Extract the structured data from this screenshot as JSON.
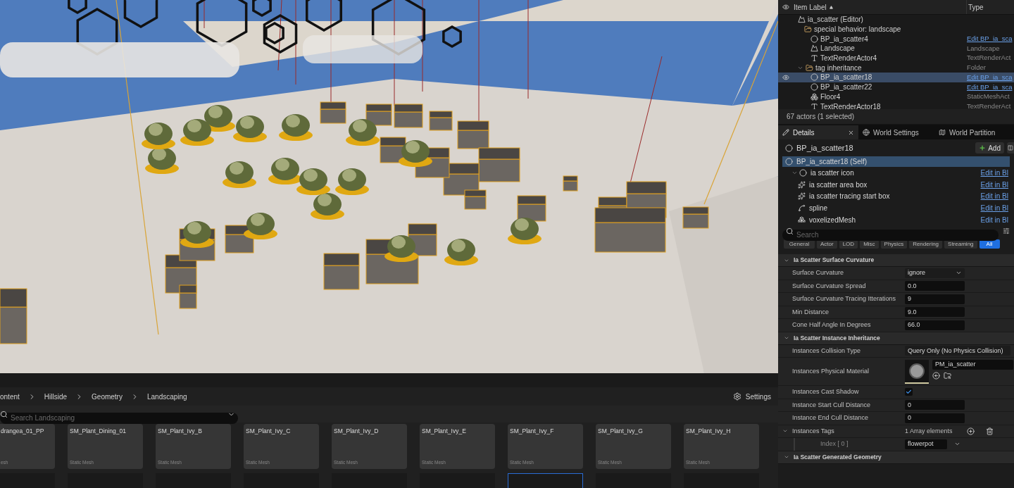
{
  "outliner": {
    "columns": [
      "Item Label",
      "Type"
    ],
    "rows": [
      {
        "label": "ia_scatter (Editor)",
        "kind": "editor",
        "selected": false,
        "visible": false,
        "children": [
          {
            "label": "special behavior: landscape",
            "kind": "folder",
            "selected": false,
            "visible": false,
            "children": [
              {
                "label": "BP_ia_scatter4",
                "kind": "actor",
                "type": "Edit BP_ia_sca",
                "link": true,
                "selected": false,
                "visible": false
              },
              {
                "label": "Landscape",
                "kind": "landscape",
                "type": "Landscape",
                "link": false,
                "selected": false,
                "visible": false
              },
              {
                "label": "TextRenderActor4",
                "kind": "text",
                "type": "TextRenderAct",
                "link": false,
                "selected": false,
                "visible": false
              }
            ]
          },
          {
            "label": "tag inheritance",
            "kind": "folder",
            "type": "Folder",
            "link": false,
            "expanded": true,
            "selected": false,
            "visible": false,
            "children": [
              {
                "label": "BP_ia_scatter18",
                "kind": "actor",
                "type": "Edit BP_ia_sca",
                "link": true,
                "selected": true,
                "visible": true
              },
              {
                "label": "BP_ia_scatter22",
                "kind": "actor",
                "type": "Edit BP_ia_sca",
                "link": true,
                "selected": false,
                "visible": false
              },
              {
                "label": "Floor4",
                "kind": "mesh",
                "type": "StaticMeshAct",
                "link": false,
                "selected": false,
                "visible": false
              },
              {
                "label": "TextRenderActor18",
                "kind": "text",
                "type": "TextRenderAct",
                "link": false,
                "selected": false,
                "visible": false
              }
            ]
          }
        ]
      }
    ],
    "status": "67 actors (1 selected)"
  },
  "details": {
    "tabs": [
      {
        "label": "Details",
        "kind": "details",
        "selected": true,
        "closable": true
      },
      {
        "label": "World Settings",
        "kind": "world",
        "selected": false,
        "closable": false
      },
      {
        "label": "World Partition",
        "kind": "partition",
        "selected": false,
        "closable": false
      }
    ],
    "actor_name": "BP_ia_scatter18",
    "add_button": "Add",
    "components": [
      {
        "label": "BP_ia_scatter18 (Self)",
        "kind": "actor",
        "selected": true,
        "children": [
          {
            "label": "ia scatter icon",
            "kind": "sphere",
            "link": "Edit in Bl",
            "expanded": true,
            "selected": false,
            "children": [
              {
                "label": "ia scatter area box",
                "kind": "box",
                "link": "Edit in Bl",
                "selected": false
              },
              {
                "label": "ia scatter tracing start box",
                "kind": "box",
                "link": "Edit in Bl",
                "selected": false
              },
              {
                "label": "spline",
                "kind": "spline",
                "link": "Edit in Bl",
                "selected": false
              },
              {
                "label": "voxelizedMesh",
                "kind": "mesh",
                "link": "Edit in Bl",
                "selected": false
              }
            ]
          }
        ]
      }
    ],
    "search": {
      "placeholder": "Search"
    },
    "filters": [
      {
        "label": "General",
        "selected": false
      },
      {
        "label": "Actor",
        "selected": false
      },
      {
        "label": "LOD",
        "selected": false
      },
      {
        "label": "Misc",
        "selected": false
      },
      {
        "label": "Physics",
        "selected": false
      },
      {
        "label": "Rendering",
        "selected": false
      },
      {
        "label": "Streaming",
        "selected": false
      },
      {
        "label": "All",
        "selected": true
      }
    ],
    "sections": [
      {
        "title": "Ia Scatter Surface Curvature",
        "expanded": true,
        "properties": [
          {
            "kind": "dropdown",
            "label": "Surface Curvature",
            "value": "ignore"
          },
          {
            "kind": "number",
            "label": "Surface Curvature Spread",
            "value": "0.0"
          },
          {
            "kind": "number",
            "label": "Surface Curvature Tracing Itterations",
            "value": "9"
          },
          {
            "kind": "number",
            "label": "Min Distance",
            "value": "9.0"
          },
          {
            "kind": "number",
            "label": "Cone Half Angle In Degrees",
            "value": "66.0"
          }
        ]
      },
      {
        "title": "Ia Scatter Instance Inheritance",
        "expanded": true,
        "properties": [
          {
            "kind": "dropdown",
            "label": "Instances Collision Type",
            "value": "Query Only (No Physics Collision)"
          },
          {
            "kind": "material",
            "label": "Instances Physical Material",
            "value": "PM_ia_scatter"
          },
          {
            "kind": "checkbox",
            "label": "Instances Cast Shadow",
            "checked": true
          },
          {
            "kind": "number",
            "label": "Instance Start Cull Distance",
            "value": "0"
          },
          {
            "kind": "number",
            "label": "Instance End Cull Distance",
            "value": "0"
          },
          {
            "kind": "array",
            "label": "Instances Tags",
            "value": "1 Array elements",
            "expanded": true
          },
          {
            "kind": "element",
            "label": "Index [ 0 ]",
            "value": "flowerpot"
          }
        ]
      },
      {
        "title": "Ia Scatter Generated Geometry",
        "expanded": true
      }
    ]
  },
  "content_browser": {
    "breadcrumb": [
      "ontent",
      "Hillside",
      "Geometry",
      "Landscaping"
    ],
    "settings": "Settings",
    "search": {
      "placeholder": "Search Landscaping"
    },
    "assets": [
      {
        "name": "drangea_01_PP",
        "type": "esh"
      },
      {
        "name": "SM_Plant_Dining_01",
        "type": "Static Mesh"
      },
      {
        "name": "SM_Plant_Ivy_B",
        "type": "Static Mesh"
      },
      {
        "name": "SM_Plant_Ivy_C",
        "type": "Static Mesh"
      },
      {
        "name": "SM_Plant_Ivy_D",
        "type": "Static Mesh"
      },
      {
        "name": "SM_Plant_Ivy_E",
        "type": "Static Mesh"
      },
      {
        "name": "SM_Plant_Ivy_F",
        "type": "Static Mesh"
      },
      {
        "name": "SM_Plant_Ivy_G",
        "type": "Static Mesh"
      },
      {
        "name": "SM_Plant_Ivy_H",
        "type": "Static Mesh"
      }
    ],
    "thumbnails": [
      {
        "selected": false
      },
      {
        "selected": false
      },
      {
        "selected": false
      },
      {
        "selected": false
      },
      {
        "selected": false
      },
      {
        "selected": false
      },
      {
        "selected": true
      },
      {
        "selected": false
      },
      {
        "selected": false
      }
    ]
  }
}
